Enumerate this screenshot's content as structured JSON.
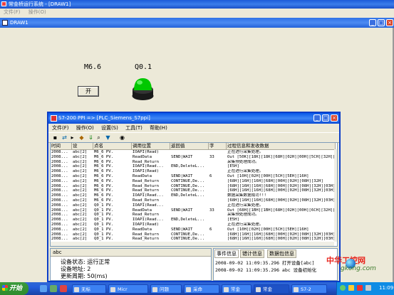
{
  "app": {
    "title": "常金桥运行系统 - [DRAW1]",
    "menu": [
      "文件(F)",
      "操作(O)"
    ]
  },
  "draw_window": {
    "title": "DRAW1"
  },
  "canvas": {
    "label_m66": "M6.6",
    "label_q01": "Q0.1",
    "open_button": "开",
    "lamp_color": "#00CC00"
  },
  "popup": {
    "title": "S7-200 PPI => [PLC_Siemens_S7ppi]",
    "menu": [
      "文件(F)",
      "操作(O)",
      "设置(S)",
      "工具(T)",
      "帮助(H)"
    ],
    "toolbar_icons": [
      "save-icon",
      "connect-icon",
      "step-icon",
      "bookmark-icon",
      "arrow-down-icon",
      "zoom-icon",
      "filter-icon",
      "eye-icon"
    ],
    "columns": [
      "时间",
      "设",
      "点名",
      "调用位置",
      "返回值",
      "字",
      "过程信息和发收数据"
    ],
    "rows": [
      [
        "2008...",
        "abc[2]",
        "M6_6 PV.",
        "IOAPI(Read)",
        "",
        "",
        "正在进行采集处理。"
      ],
      [
        "2008...",
        "abc[2]",
        "M6_6 PV.",
        "ReadData",
        "SEND|WAIT",
        "33",
        "Out  [50K][18K][18K][68H][02H][00H][5CH][32H][D"
      ],
      [
        "2008...",
        "abc[2]",
        "M6_6 PV.",
        "Read_Return",
        "",
        "",
        "采集预处理成功。"
      ],
      [
        "2008...",
        "abc[2]",
        "M6_6 PV.",
        "IOAPI(Read...",
        "END,DeleteL...",
        "",
        "[E5H]"
      ],
      [
        "2008...",
        "abc[2]",
        "M6_6 PV.",
        "IOAPI(Read)",
        "",
        "",
        "正在进行采集处理。"
      ],
      [
        "2008...",
        "abc[2]",
        "M6_6 PV.",
        "ReadData",
        "SEND|WAIT",
        "6",
        "Out  [10H][02H][00H][5CH][5EH][16H]"
      ],
      [
        "2008...",
        "abc[2]",
        "M6_6 PV.",
        "Read_Return",
        "CONTINUE,De...",
        "",
        "[68H][16H][16H][68H][00H][02H][08H][32H]"
      ],
      [
        "2008...",
        "abc[2]",
        "M6_6 PV.",
        "Read_Return",
        "CONTINUE,De...",
        "",
        "[68H][16H][16H][68H][00H][02H][08H][32H][03H][00H]"
      ],
      [
        "2008...",
        "abc[2]",
        "M6_6 PV.",
        "Read_Return",
        "CONTINUE,De...",
        "",
        "[68H][16H][16H][68H][00H][02H][08H][32H][03H][00H]"
      ],
      [
        "2008...",
        "abc[2]",
        "M6_6 PV.",
        "IOAPI(Read...",
        "END,DeleteL...",
        "",
        "数据采集数据成功!!!"
      ],
      [
        "2008...",
        "abc[2]",
        "M6_6 PV.",
        "Read_Return",
        "",
        "",
        "[68H][16H][16H][68H][00H][02H][08H][32H][03H][00H]"
      ],
      [
        "2008...",
        "abc[2]",
        "Q0_1 PV.",
        "IOAPI(Read...",
        "",
        "",
        "正在进行采集处理。"
      ],
      [
        "2008...",
        "abc[2]",
        "Q0_1 PV.",
        "ReadData",
        "SEND|WAIT",
        "33",
        "Out  [68H][1BH][1BH][68H][02H][00H][6CH][32H][D"
      ],
      [
        "2008...",
        "abc[2]",
        "Q0_1 PV.",
        "Read_Return",
        "",
        "",
        "采集预处理成功。"
      ],
      [
        "2008...",
        "abc[2]",
        "Q0_1 PV.",
        "IOAPI(Read...",
        "END,DeleteL...",
        "",
        "[E5H]"
      ],
      [
        "2008...",
        "abc[2]",
        "Q0_1 PV.",
        "IOAPI(Read)",
        "",
        "",
        "正在进行采集处理。"
      ],
      [
        "2008...",
        "abc[2]",
        "Q0_1 PV.",
        "ReadData",
        "SEND|WAIT",
        "6",
        "Out  [10H][02H][00H][5CH][5EH][16H]"
      ],
      [
        "2008...",
        "abc[2]",
        "Q0_1 PV.",
        "Read_Return",
        "CONTINUE,De...",
        "",
        "[68H][16H][16H][68H][00H][02H][08H][32H][03H][00H]"
      ],
      [
        "2008...",
        "abc[2]",
        "Q0_1 PV.",
        "Read_Return",
        "CONTINUE,De...",
        "",
        "[68H][16H][16H][68H][00H][02H][08H][32H][03H][00H]"
      ]
    ],
    "left_panel": {
      "header": "abc",
      "status_lines": [
        "设备状态: 运行正常",
        "设备地址: 2",
        "更新周期: 50(ms)"
      ]
    },
    "right_panel": {
      "tabs": [
        "事件信息",
        "错计信息",
        "数据包信息"
      ],
      "events": [
        "2008-09-02 11:09:35.296  打开设备[abc]",
        "2008-09-02 11:09:35.296  abc 设备初始化"
      ]
    }
  },
  "taskbar": {
    "start_label": "开始",
    "tasks": [
      "无标",
      "Micr",
      "问题",
      "采命",
      "常金",
      "常金",
      "S7-2"
    ],
    "clock": "11:09"
  },
  "watermark": {
    "line1": "中华工控网",
    "line2": "gkong.com"
  }
}
